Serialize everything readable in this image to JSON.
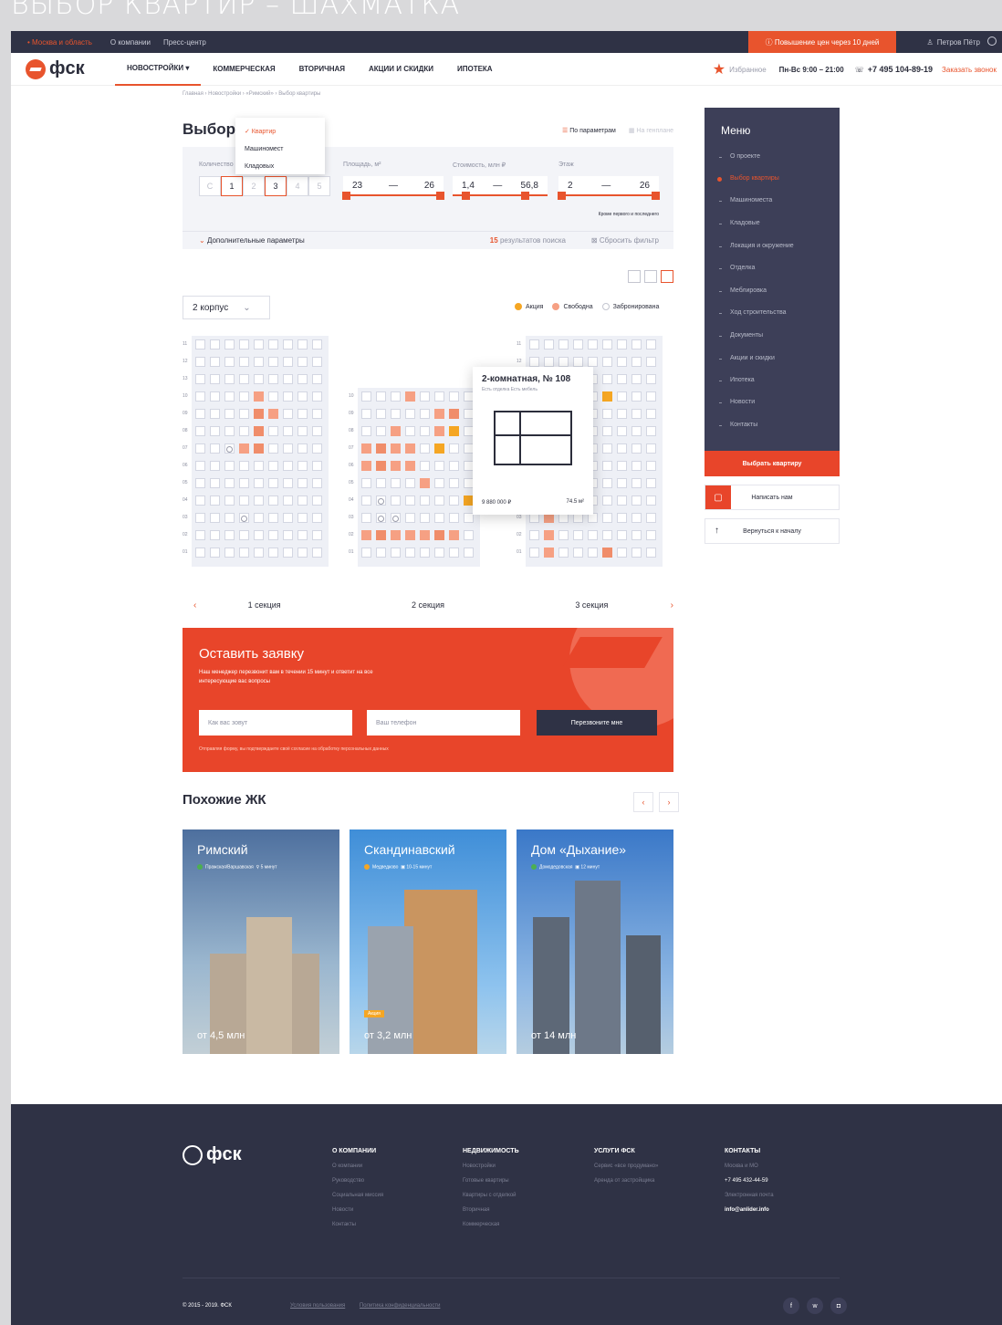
{
  "page_title": "ВЫБОР КВАРТИР – ШАХМАТКА",
  "topbar": {
    "region": "• Москва и область",
    "links": [
      "О компании",
      "Пресс-центр"
    ],
    "promo": "ⓘ Повышение цен через 10 дней",
    "user": "Петров Пётр"
  },
  "header": {
    "logo": "фск",
    "nav": [
      "Новостройки",
      "Коммерческая",
      "Вторичная",
      "Акции и скидки",
      "Ипотека"
    ],
    "fav": "Избранное",
    "hours": "Пн-Вс 9:00 – 21:00",
    "phone": "+7 495 104-89-19",
    "call": "Заказать звонок"
  },
  "breadcrumbs": "Главная › Новостройки › «Римский» › Выбор квартиры",
  "filters": {
    "title": "Выбор",
    "type_options": [
      "✓ Квартир",
      "Машиномест",
      "Кладовых"
    ],
    "by_params": "По параметрам",
    "on_plan": "На генплане",
    "rooms_label": "Количество",
    "rooms": [
      "С",
      "1",
      "2",
      "3",
      "4",
      "5"
    ],
    "area_label": "Площадь, м²",
    "area": [
      "23",
      "26"
    ],
    "price_label": "Стоимость, млн ₽",
    "price": [
      "1,4",
      "56,8"
    ],
    "floor_label": "Этаж",
    "floor": [
      "2",
      "26"
    ],
    "floor_note": "Кроме первого и последнего",
    "advanced": "Дополнительные параметры",
    "results_count": "15",
    "results_text": "результатов поиска",
    "reset": "Сбросить фильтр"
  },
  "building": "2 корпус",
  "legend": [
    {
      "label": "Акция",
      "color": "#f5a623"
    },
    {
      "label": "Свободна",
      "color": "#f6a083"
    },
    {
      "label": "Забронирована",
      "color": "#c4c6d0"
    }
  ],
  "popup": {
    "title": "2-комнатная, № 108",
    "tags": "Есть отделка   Есть мебель",
    "price": "9 880 000 ₽",
    "area": "74.5 м²"
  },
  "sections": [
    "1 секция",
    "2 секция",
    "3 секция"
  ],
  "floors": [
    "11",
    "12",
    "13",
    "10",
    "09",
    "08",
    "07",
    "06",
    "05",
    "04",
    "03",
    "02",
    "01"
  ],
  "request": {
    "title": "Оставить заявку",
    "subtitle": "Наш менеджер перезвонит вам в течении 15 минут и ответит на все интересующие вас вопросы",
    "name_placeholder": "Как вас зовут",
    "phone_placeholder": "Ваш телефон",
    "button": "Перезвоните мне",
    "agree": "Отправляя форму, вы подтверждаете своё согласие на обработку персональных данных"
  },
  "similar": {
    "title": "Похожие ЖК",
    "cards": [
      {
        "name": "Римский",
        "metro": "Пражская/Варшавская",
        "time": "5 минут",
        "price": "от 4,5 млн"
      },
      {
        "name": "Скандинавский",
        "metro": "Медведково",
        "time": "10-15 минут",
        "price": "от 3,2 млн",
        "tag": "Акция"
      },
      {
        "name": "Дом «Дыхание»",
        "metro": "Домодедовская",
        "time": "12 минут",
        "price": "от 14 млн"
      }
    ]
  },
  "side_menu": {
    "title": "Меню",
    "items": [
      "О проекте",
      "Выбор квартиры",
      "Машиноместа",
      "Кладовые",
      "Локация и окружение",
      "Отделка",
      "Меблировка",
      "Ход строительства",
      "Документы",
      "Акции и скидки",
      "Ипотека",
      "Новости",
      "Контакты"
    ],
    "active": "Выбор квартиры",
    "cta": "Выбрать квартиру",
    "write": "Написать нам",
    "back": "Вернуться к началу"
  },
  "footer": {
    "logo": "фск",
    "cols": [
      {
        "h": "О КОМПАНИИ",
        "items": [
          "О компании",
          "Руководство",
          "Социальная миссия",
          "Новости",
          "Контакты"
        ]
      },
      {
        "h": "НЕДВИЖИМОСТЬ",
        "items": [
          "Новостройки",
          "Готовые квартиры",
          "Квартиры с отделкой",
          "Вторичная",
          "Коммерческая"
        ]
      },
      {
        "h": "УСЛУГИ ФСК",
        "items": [
          "Сервис «все продумано»",
          "Аренда от застройщика"
        ]
      },
      {
        "h": "КОНТАКТЫ",
        "items": [
          "Москва и МО",
          "+7 495 432-44-59",
          "Электронная почта",
          "info@anlider.info"
        ]
      }
    ],
    "copy": "© 2015 - 2019. ФСК",
    "links": [
      "Условия пользования",
      "Политика конфиденциальности"
    ]
  },
  "colors": {
    "accent": "#e8542d",
    "dark": "#2f3245"
  }
}
